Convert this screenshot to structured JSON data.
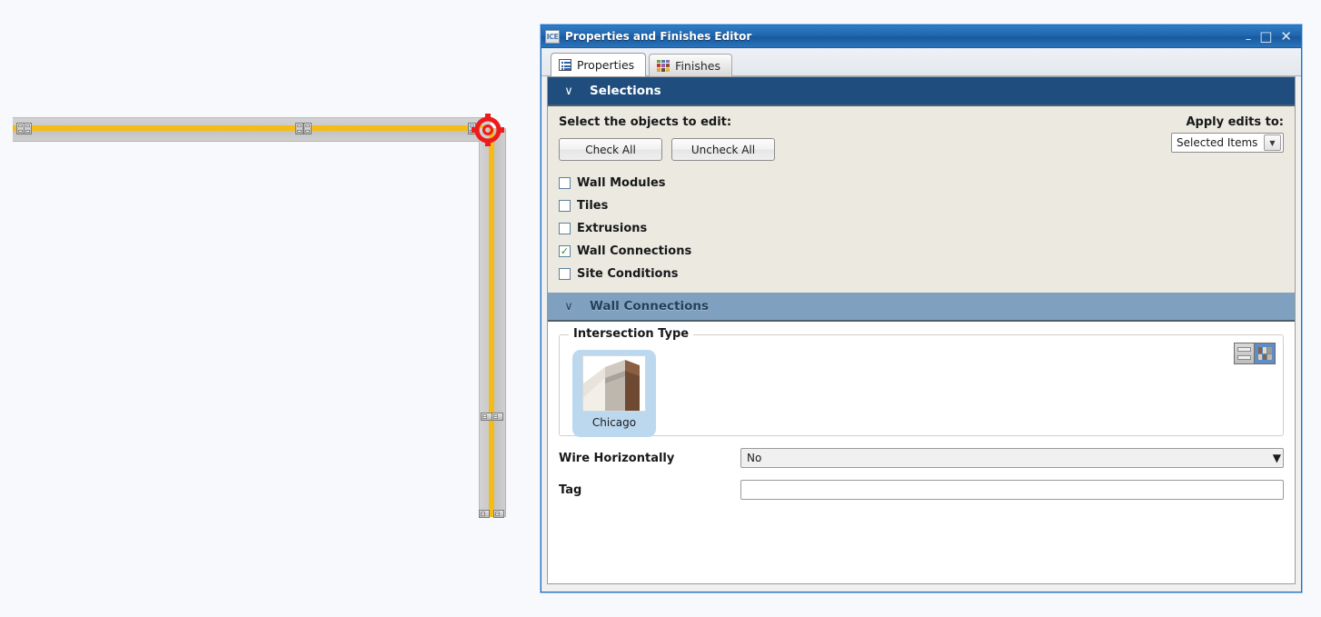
{
  "window": {
    "title": "Properties and Finishes Editor",
    "logo_text": "ICE",
    "logo_icon": "ice-app-icon",
    "controls": {
      "minimize": "–",
      "maximize": "□",
      "close": "✕"
    }
  },
  "tabs": [
    {
      "label": "Properties",
      "icon": "list-icon",
      "active": true
    },
    {
      "label": "Finishes",
      "icon": "color-grid-icon",
      "active": false
    }
  ],
  "selections": {
    "header": "Selections",
    "chevron": "∨",
    "instruction": "Select the objects to edit:",
    "check_all": "Check All",
    "uncheck_all": "Uncheck All",
    "apply_label": "Apply edits to:",
    "apply_value": "Selected Items",
    "apply_arrow": "▼",
    "items": [
      {
        "label": "Wall Modules",
        "checked": false
      },
      {
        "label": "Tiles",
        "checked": false
      },
      {
        "label": "Extrusions",
        "checked": false
      },
      {
        "label": "Wall Connections",
        "checked": true
      },
      {
        "label": "Site Conditions",
        "checked": false
      }
    ],
    "check_glyph": "✓"
  },
  "wall_connections": {
    "header": "Wall Connections",
    "chevron": "∨",
    "group_legend": "Intersection Type",
    "selected_thumb": "Chicago",
    "view_toggle": {
      "list_icon": "list-view-icon",
      "grid_icon": "grid-view-icon",
      "active": "grid"
    },
    "fields": [
      {
        "label": "Wire Horizontally",
        "value": "No",
        "type": "combo",
        "arrow": "▼"
      },
      {
        "label": "Tag",
        "value": "",
        "type": "text"
      }
    ]
  },
  "canvas": {
    "name": "floorplan-canvas",
    "walls": [
      {
        "name": "horizontal-wall",
        "orientation": "horizontal"
      },
      {
        "name": "vertical-wall",
        "orientation": "vertical"
      }
    ],
    "selection_marker": "rotation-handle"
  },
  "colors": {
    "titlebar": "#1f65ad",
    "section_dark": "#1f4d7d",
    "section_light": "#7fa1bf",
    "panel_bg": "#ece9e1",
    "wall_line": "#f5bc17",
    "wall_body": "#c9c9c9",
    "marker_red": "#ee1b1b",
    "thumb_selected": "#bcd8ef",
    "check_green": "#2f8a2f"
  }
}
